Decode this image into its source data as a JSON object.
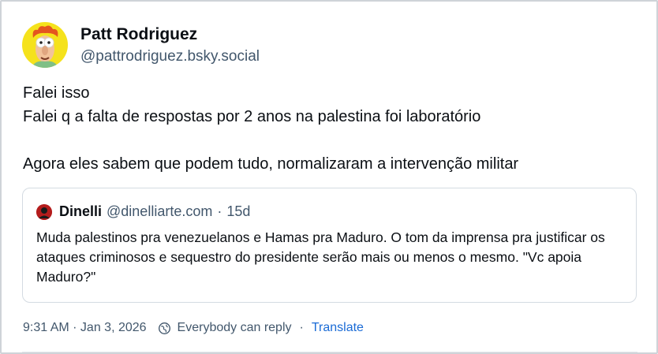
{
  "post": {
    "author": {
      "display_name": "Patt Rodriguez",
      "handle": "@pattrodriguez.bsky.social",
      "avatar_icon": "muppet-beaker-avatar"
    },
    "text_lines": [
      "Falei isso",
      "Falei q a falta de respostas por 2 anos na palestina foi laboratório",
      "",
      "Agora eles sabem que podem tudo, normalizaram a intervenção militar"
    ],
    "quote": {
      "author_name": "Dinelli",
      "author_handle": "@dinelliarte.com",
      "separator": "·",
      "time_ago": "15d",
      "text": "Muda palestinos pra venezuelanos e Hamas pra Maduro. O tom da imprensa pra justificar os ataques criminosos e sequestro do presidente serão mais ou menos o mesmo. \"Vc apoia Maduro?\""
    },
    "meta": {
      "timestamp": "9:31 AM · Jan 3, 2026",
      "reply_setting": "Everybody can reply",
      "separator": "·",
      "translate_label": "Translate"
    }
  },
  "colors": {
    "text": "#0b0f14",
    "muted": "#42576c",
    "link": "#1a6bd6",
    "border": "#d4dbe2"
  }
}
